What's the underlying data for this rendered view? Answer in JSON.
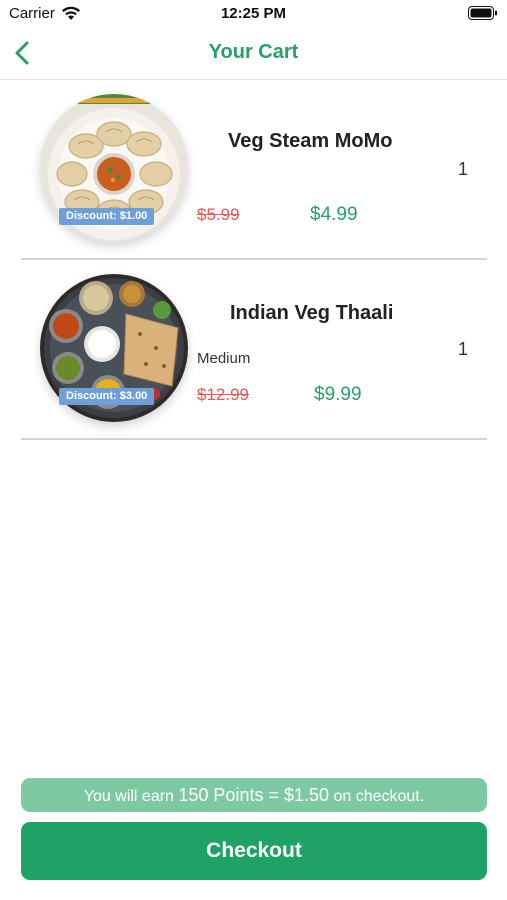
{
  "status_bar": {
    "carrier": "Carrier",
    "time": "12:25 PM"
  },
  "nav": {
    "title": "Your Cart",
    "back_icon": "chevron-left-icon"
  },
  "cart": {
    "items": [
      {
        "name": "Veg Steam MoMo",
        "variant": "",
        "quantity": "1",
        "original_price": "$5.99",
        "price": "$4.99",
        "discount_label": "Discount: $1.00"
      },
      {
        "name": "Indian Veg Thaali",
        "variant": "Medium",
        "quantity": "1",
        "original_price": "$12.99",
        "price": "$9.99",
        "discount_label": "Discount: $3.00"
      }
    ]
  },
  "footer": {
    "points_prefix": "You will earn ",
    "points_value": "150 Points = $1.50",
    "points_suffix": " on checkout.",
    "checkout_label": "Checkout"
  },
  "colors": {
    "accent": "#27a067",
    "checkout_button": "#1fa266",
    "points_banner": "#7ec9a2",
    "strike_price": "#e85656",
    "discount_badge": "#6f9fd8"
  }
}
